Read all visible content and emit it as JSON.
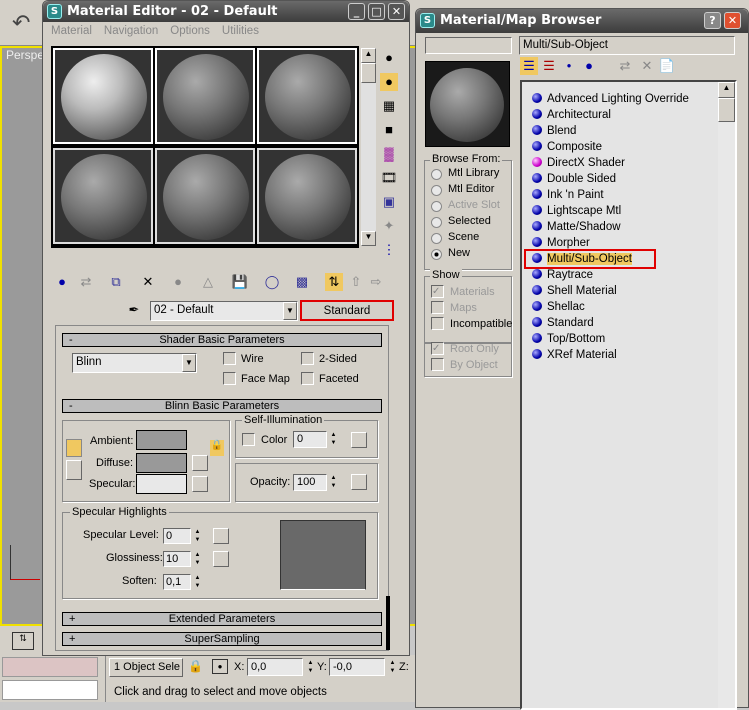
{
  "background": {
    "viewport_label": "Perspe"
  },
  "material_editor": {
    "title": "Material Editor - 02 - Default",
    "menu": [
      "Material",
      "Navigation",
      "Options",
      "Utilities"
    ],
    "material_name": "02 - Default",
    "material_type_button": "Standard",
    "shader_rollout": {
      "title": "Shader Basic Parameters",
      "toggle": "-",
      "shader": "Blinn",
      "wire": "Wire",
      "two_sided": "2-Sided",
      "face_map": "Face Map",
      "faceted": "Faceted"
    },
    "blinn_rollout": {
      "title": "Blinn Basic Parameters",
      "toggle": "-",
      "ambient": "Ambient:",
      "diffuse": "Diffuse:",
      "specular": "Specular:",
      "self_illum_title": "Self-Illumination",
      "color_label": "Color",
      "color_value": "0",
      "opacity_label": "Opacity:",
      "opacity_value": "100",
      "spec_title": "Specular Highlights",
      "spec_level_label": "Specular Level:",
      "spec_level_value": "0",
      "gloss_label": "Glossiness:",
      "gloss_value": "10",
      "soften_label": "Soften:",
      "soften_value": "0,1"
    },
    "extended_rollout": {
      "title": "Extended Parameters",
      "toggle": "+"
    },
    "supersampling_rollout": {
      "title": "SuperSampling",
      "toggle": "+"
    }
  },
  "status_bar": {
    "selection": "1 Object Sele",
    "x_label": "X:",
    "x_value": "0,0",
    "y_label": "Y:",
    "y_value": "-0,0",
    "z_label": "Z:",
    "prompt": "Click and drag to select and move objects"
  },
  "browser": {
    "title": "Material/Map Browser",
    "name_field": "",
    "selected_name": "Multi/Sub-Object",
    "browse_from": {
      "title": "Browse From:",
      "options": [
        "Mtl Library",
        "Mtl Editor",
        "Active Slot",
        "Selected",
        "Scene",
        "New"
      ],
      "selected": "New"
    },
    "show": {
      "title": "Show",
      "materials": "Materials",
      "maps": "Maps",
      "incompatible": "Incompatible"
    },
    "root_only": "Root Only",
    "by_object": "By Object",
    "items": [
      "Advanced Lighting Override",
      "Architectural",
      "Blend",
      "Composite",
      "DirectX Shader",
      "Double Sided",
      "Ink 'n Paint",
      "Lightscape Mtl",
      "Matte/Shadow",
      "Morpher",
      "Multi/Sub-Object",
      "Raytrace",
      "Shell Material",
      "Shellac",
      "Standard",
      "Top/Bottom",
      "XRef Material"
    ],
    "selected_item": "Multi/Sub-Object",
    "highlight_color": "#f0c860",
    "annotation_color": "#e00000"
  }
}
